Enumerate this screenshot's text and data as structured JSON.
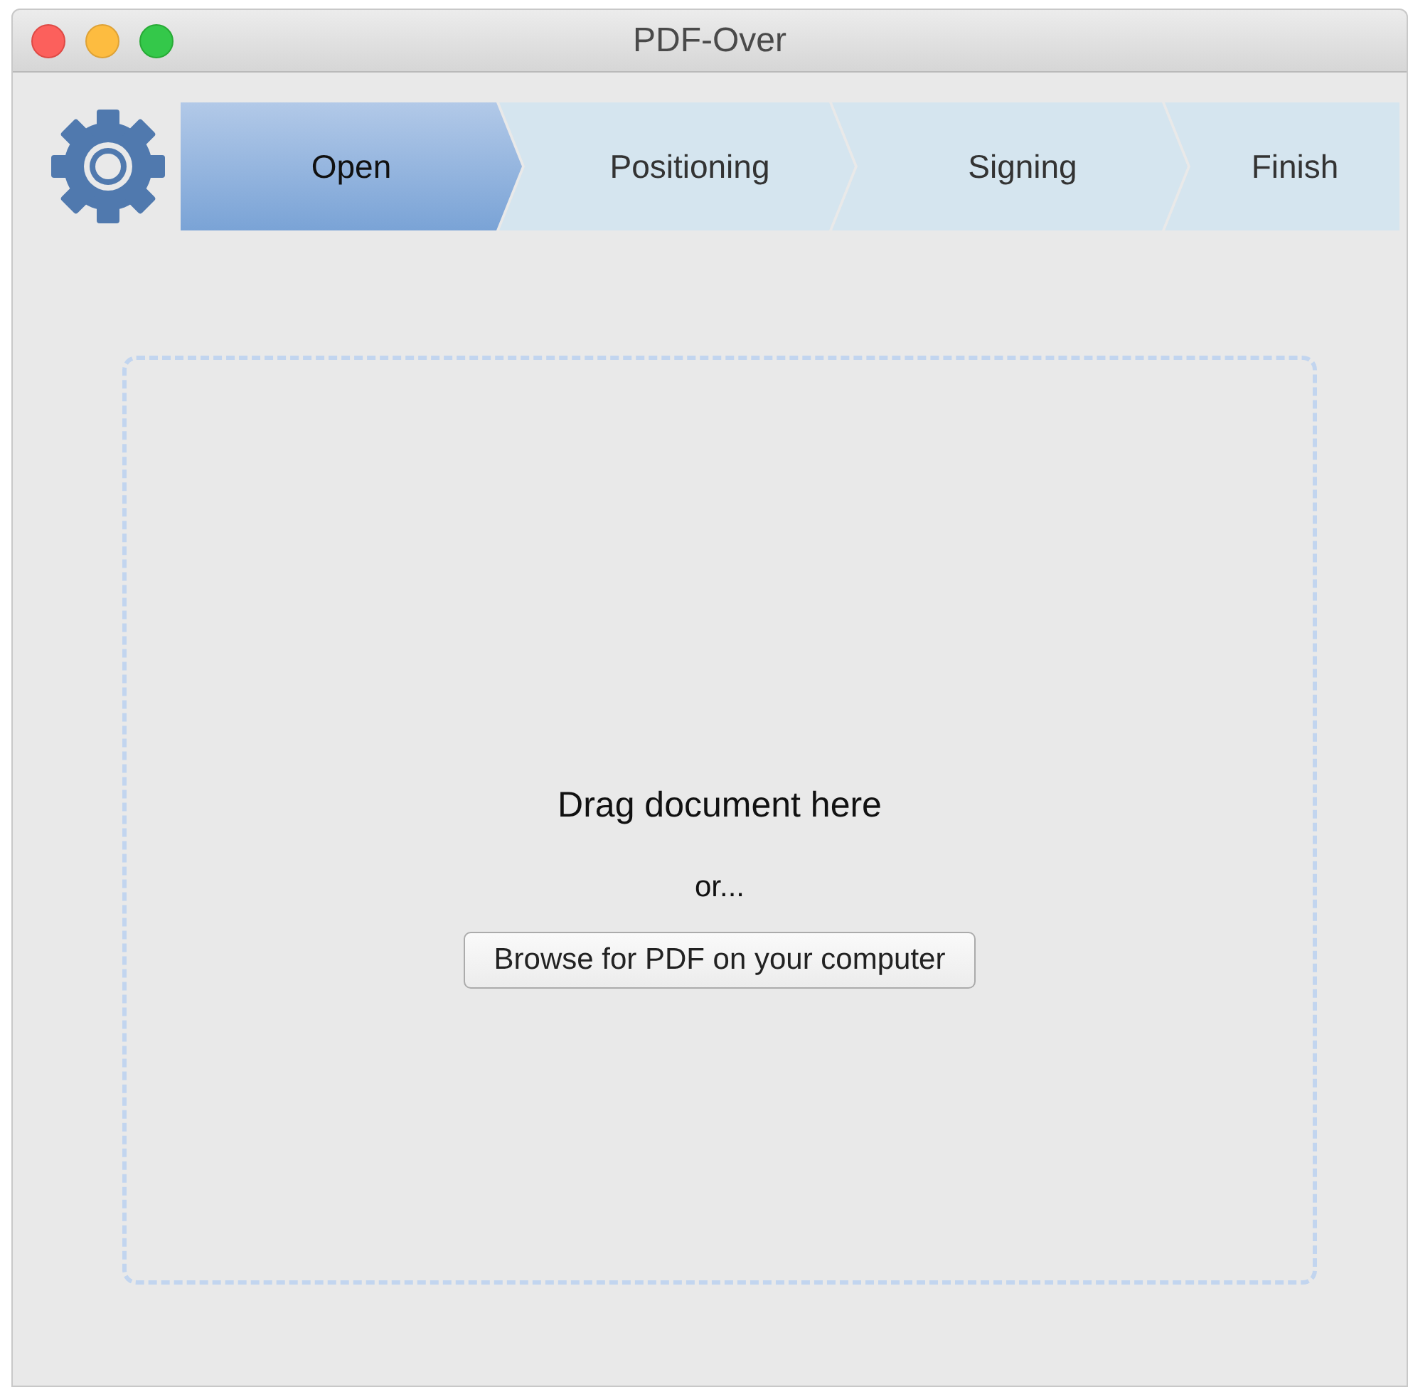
{
  "window": {
    "title": "PDF-Over"
  },
  "steps": [
    {
      "label": "Open",
      "selected": true
    },
    {
      "label": "Positioning",
      "selected": false
    },
    {
      "label": "Signing",
      "selected": false
    },
    {
      "label": "Finish",
      "selected": false
    }
  ],
  "drop_zone": {
    "heading": "Drag document here",
    "separator": "or...",
    "button": "Browse for PDF on your computer"
  }
}
